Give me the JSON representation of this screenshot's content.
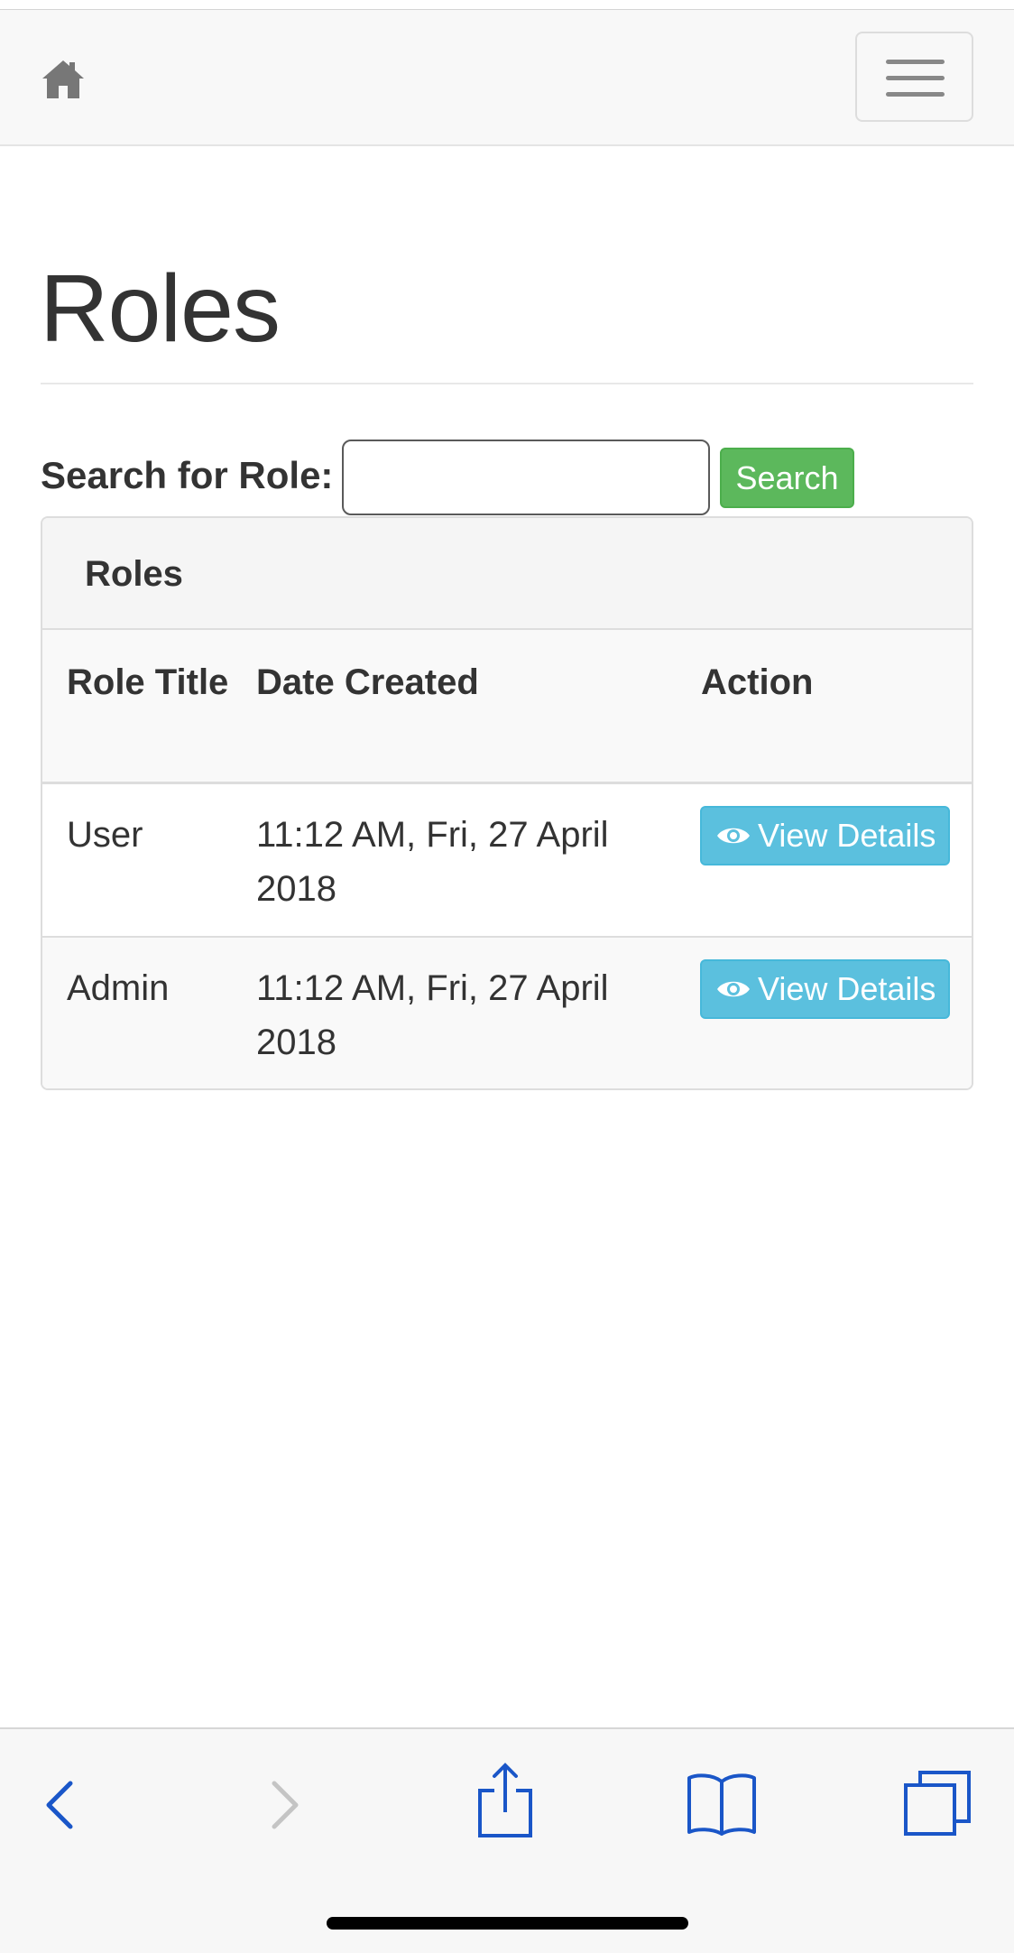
{
  "navbar": {
    "home_icon": "home-icon",
    "menu_icon": "hamburger-menu-icon"
  },
  "page": {
    "title": "Roles"
  },
  "search": {
    "label": "Search for Role:",
    "input_value": "",
    "placeholder": "",
    "button_label": "Search"
  },
  "panel": {
    "title": "Roles",
    "columns": [
      "Role Title",
      "Date Created",
      "Action"
    ],
    "rows": [
      {
        "role_title": "User",
        "date_created": "11:12 AM, Fri, 27 April 2018",
        "action_label": "View Details"
      },
      {
        "role_title": "Admin",
        "date_created": "11:12 AM, Fri, 27 April 2018",
        "action_label": "View Details"
      }
    ]
  },
  "browser_toolbar": {
    "icons": [
      "back-arrow-icon",
      "forward-arrow-icon",
      "share-icon",
      "bookmarks-icon",
      "tabs-icon"
    ]
  },
  "colors": {
    "success": "#5cb85c",
    "info": "#5bc0de",
    "ios_blue": "#1a56c8",
    "ios_disabled": "#c4c4c4"
  }
}
